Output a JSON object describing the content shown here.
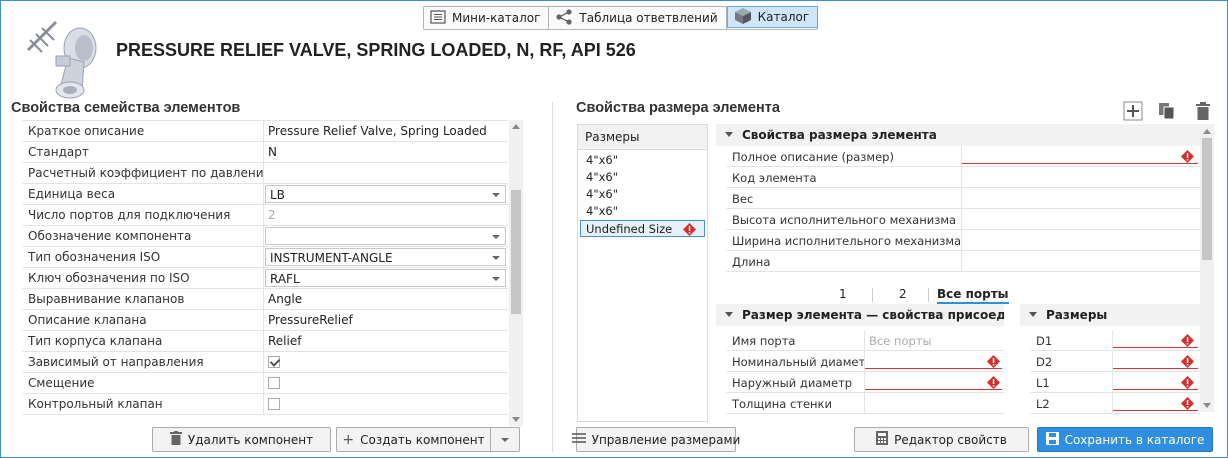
{
  "tabs": [
    {
      "label": "Мини-каталог",
      "icon": "list-icon",
      "active": false
    },
    {
      "label": "Таблица ответвлений",
      "icon": "share-icon",
      "active": false
    },
    {
      "label": "Каталог",
      "icon": "cube-icon",
      "active": true
    }
  ],
  "header": {
    "title": "PRESSURE RELIEF VALVE, SPRING LOADED, N, RF, API 526"
  },
  "family": {
    "title": "Свойства семейства элементов",
    "rows": [
      {
        "label": "Краткое описание",
        "value": "Pressure Relief Valve, Spring Loaded"
      },
      {
        "label": "Стандарт",
        "value": "N"
      },
      {
        "label": "Расчетный коэффициент по давлению",
        "value": ""
      },
      {
        "label": "Единица веса",
        "value": "LB",
        "type": "combo"
      },
      {
        "label": "Число портов для подключения",
        "value": "2",
        "disabled": true
      },
      {
        "label": "Обозначение компонента",
        "value": "",
        "type": "combo"
      },
      {
        "label": "Тип обозначения ISO",
        "value": "INSTRUMENT-ANGLE",
        "type": "combo"
      },
      {
        "label": "Ключ обозначения по ISO",
        "value": "RAFL",
        "type": "combo"
      },
      {
        "label": "Выравнивание клапанов",
        "value": "Angle"
      },
      {
        "label": "Описание клапана",
        "value": "PressureRelief"
      },
      {
        "label": "Тип корпуса клапана",
        "value": "Relief"
      },
      {
        "label": "Зависимый от направления",
        "value": "",
        "type": "check",
        "checked": true
      },
      {
        "label": "Смещение",
        "value": "",
        "type": "check",
        "checked": false
      },
      {
        "label": "Контрольный клапан",
        "value": "",
        "type": "check",
        "checked": false
      }
    ],
    "delete_label": "Удалить компонент",
    "create_label": "Создать компонент"
  },
  "size": {
    "title": "Свойства размера элемента",
    "sizes_header": "Размеры",
    "sizes": [
      "4\"x6\"",
      "4\"x6\"",
      "4\"x6\"",
      "4\"x6\"",
      "Undefined Size"
    ],
    "props_header": "Свойства размера элемента",
    "props": [
      "Полное описание (размер)",
      "Код элемента",
      "Вес",
      "Высота исполнительного механизма",
      "Ширина исполнительного механизма",
      "Длина"
    ],
    "pages": [
      "1",
      "2",
      "Все порты"
    ],
    "conn_header": "Размер элемента — свойства присоедините",
    "conn_rows": [
      {
        "label": "Имя порта",
        "value": "Все порты"
      },
      {
        "label": "Номинальный диаметр",
        "value": ""
      },
      {
        "label": "Наружный диаметр",
        "value": ""
      },
      {
        "label": "Толщина стенки",
        "value": ""
      }
    ],
    "dims_header": "Размеры",
    "dims": [
      "D1",
      "D2",
      "L1",
      "L2"
    ],
    "manage_label": "Управление размерами",
    "editor_label": "Редактор свойств",
    "save_label": "Сохранить в каталоге"
  },
  "colors": {
    "accent": "#2e8ee0",
    "warning": "#d32f2f"
  }
}
